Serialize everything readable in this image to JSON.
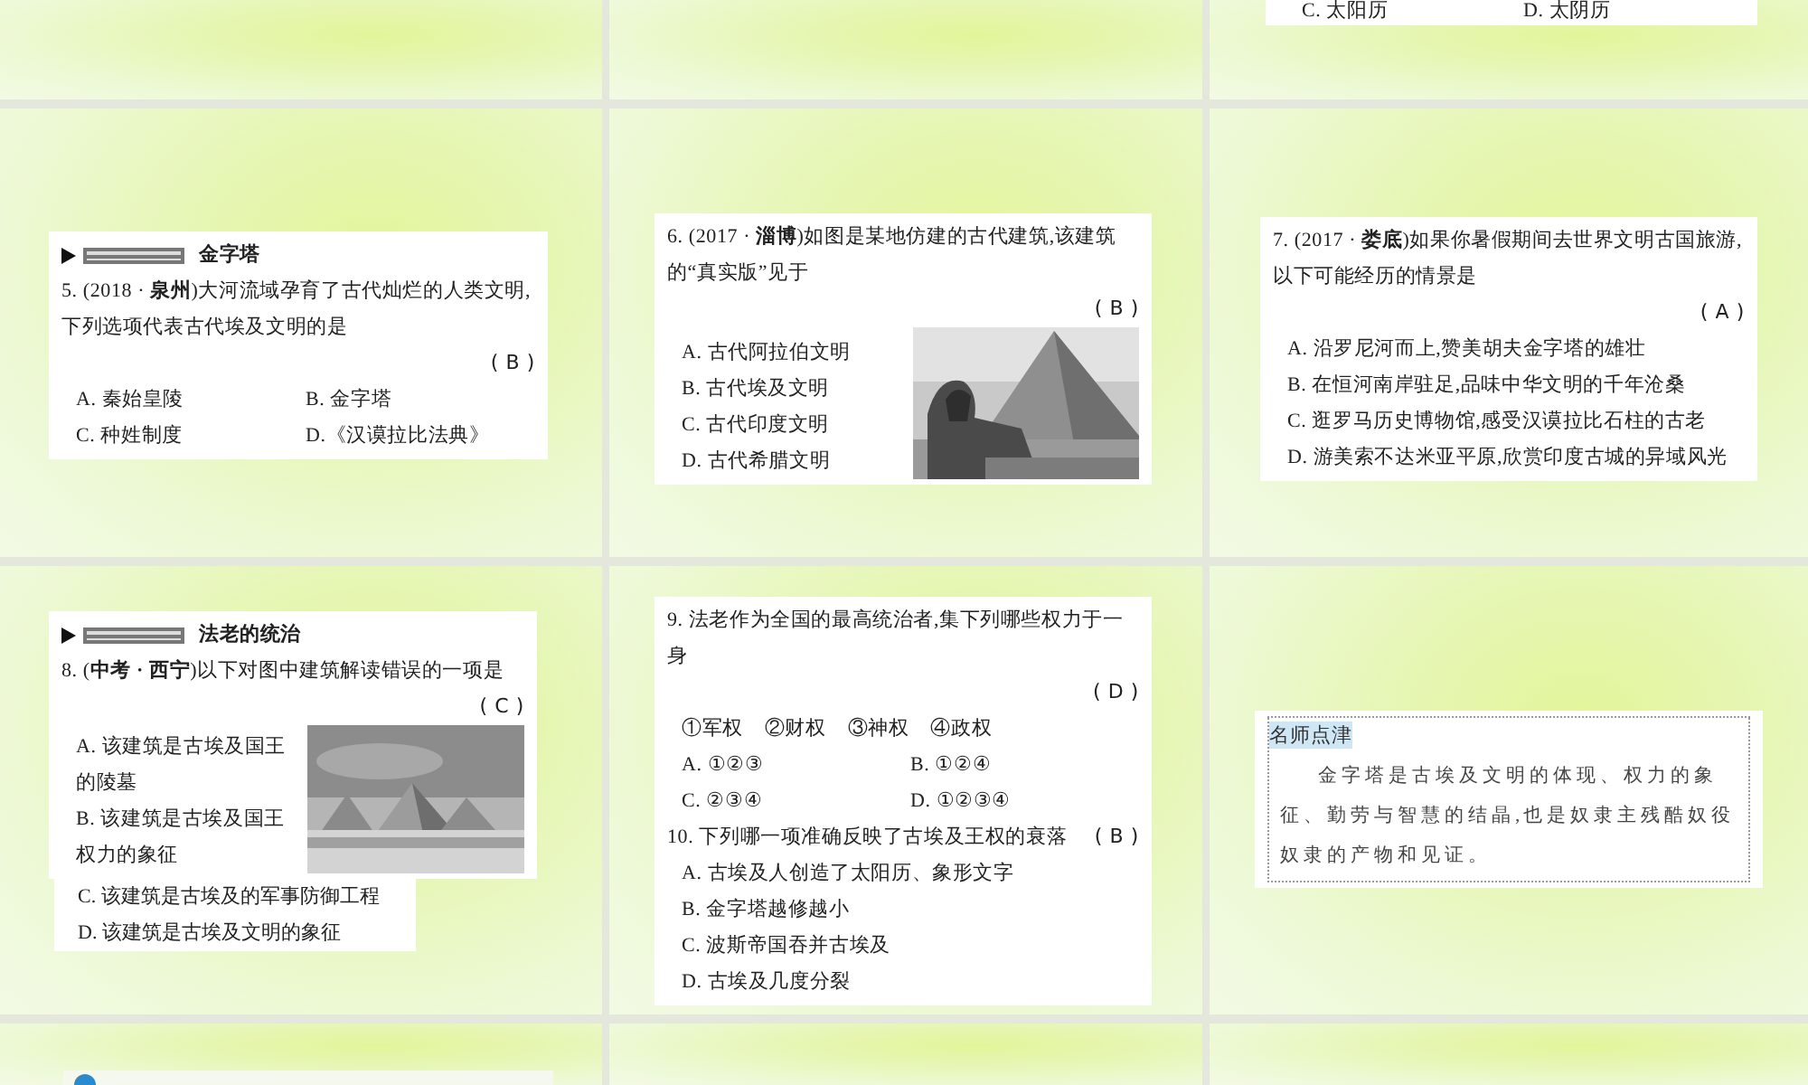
{
  "slides": [
    {
      "kind": "blank"
    },
    {
      "kind": "blank"
    },
    {
      "kind": "content",
      "cards": [
        {
          "blocks": [
            {
              "kind": "options_grid",
              "options": [
                "C. 太阳历",
                "D. 太阴历"
              ]
            }
          ]
        }
      ]
    },
    {
      "kind": "content",
      "cards": [
        {
          "blocks": [
            {
              "kind": "heading",
              "text": "金字塔"
            },
            {
              "kind": "stem",
              "text": "5. (2018 · **泉州**)大河流域孕育了古代灿烂的人类文明,下列选项代表古代埃及文明的是"
            },
            {
              "kind": "answer",
              "text": "( B )"
            },
            {
              "kind": "options_grid",
              "options": [
                "A. 秦始皇陵",
                "B. 金字塔",
                "C. 种姓制度",
                "D.《汉谟拉比法典》"
              ]
            }
          ]
        }
      ]
    },
    {
      "kind": "content",
      "cards": [
        {
          "blocks": [
            {
              "kind": "stem",
              "text": "6. (2017 · **淄博**)如图是某地仿建的古代建筑,该建筑的“真实版”见于"
            },
            {
              "kind": "answer",
              "text": "( B )"
            },
            {
              "kind": "sphinx",
              "options": [
                "A. 古代阿拉伯文明",
                "B. 古代埃及文明",
                "C. 古代印度文明",
                "D. 古代希腊文明"
              ]
            }
          ]
        }
      ]
    },
    {
      "kind": "content",
      "cards": [
        {
          "blocks": [
            {
              "kind": "stem",
              "text": "7. (2017 · **娄底**)如果你暑假期间去世界文明古国旅游,以下可能经历的情景是"
            },
            {
              "kind": "answer",
              "text": "( A )"
            },
            {
              "kind": "options_list",
              "options": [
                "A. 沿罗尼河而上,赞美胡夫金字塔的雄壮",
                "B. 在恒河南岸驻足,品味中华文明的千年沧桑",
                "C. 逛罗马历史博物馆,感受汉谟拉比石柱的古老",
                "D. 游美索不达米亚平原,欣赏印度古城的异域风光"
              ]
            }
          ]
        }
      ]
    },
    {
      "kind": "content",
      "cards": [
        {
          "blocks": [
            {
              "kind": "heading",
              "text": "法老的统治"
            },
            {
              "kind": "stem",
              "text": "8. (**中考 · 西宁**)以下对图中建筑解读错误的一项是"
            },
            {
              "kind": "answer",
              "text": "( C )"
            },
            {
              "kind": "pyramids",
              "options": [
                "A. 该建筑是古埃及国王的陵墓",
                "B. 该建筑是古埃及国王权力的象征"
              ]
            }
          ]
        },
        {
          "blocks": [
            {
              "kind": "options_list",
              "options": [
                "C. 该建筑是古埃及的军事防御工程",
                "D. 该建筑是古埃及文明的象征"
              ]
            }
          ]
        }
      ]
    },
    {
      "kind": "content",
      "cards": [
        {
          "blocks": [
            {
              "kind": "stem",
              "text": "9. 法老作为全国的最高统治者,集下列哪些权力于一身"
            },
            {
              "kind": "answer",
              "text": "( D )"
            },
            {
              "kind": "statements",
              "options": [
                "①军权",
                "②财权",
                "③神权",
                "④政权"
              ]
            },
            {
              "kind": "options_grid",
              "options": [
                "A. ①②③",
                "B. ①②④",
                "C. ②③④",
                "D. ①②③④"
              ]
            },
            {
              "kind": "stem",
              "text": "10. 下列哪一项准确反映了古埃及王权的衰落",
              "answer": "( B )"
            },
            {
              "kind": "options_list",
              "options": [
                "A. 古埃及人创造了太阳历、象形文字",
                "B. 金字塔越修越小",
                "C. 波斯帝国吞并古埃及",
                "D. 古埃及几度分裂"
              ]
            }
          ]
        }
      ]
    },
    {
      "kind": "content",
      "cards": [
        {
          "blocks": [
            {
              "kind": "note",
              "title": "名师点津",
              "text": "金字塔是古埃及文明的体现、权力的象征、勤劳与智慧的结晶,也是奴隶主残酷奴役奴隶的产物和见证。"
            }
          ]
        }
      ]
    },
    {
      "kind": "banner"
    },
    {
      "kind": "blank"
    },
    {
      "kind": "blank"
    }
  ]
}
